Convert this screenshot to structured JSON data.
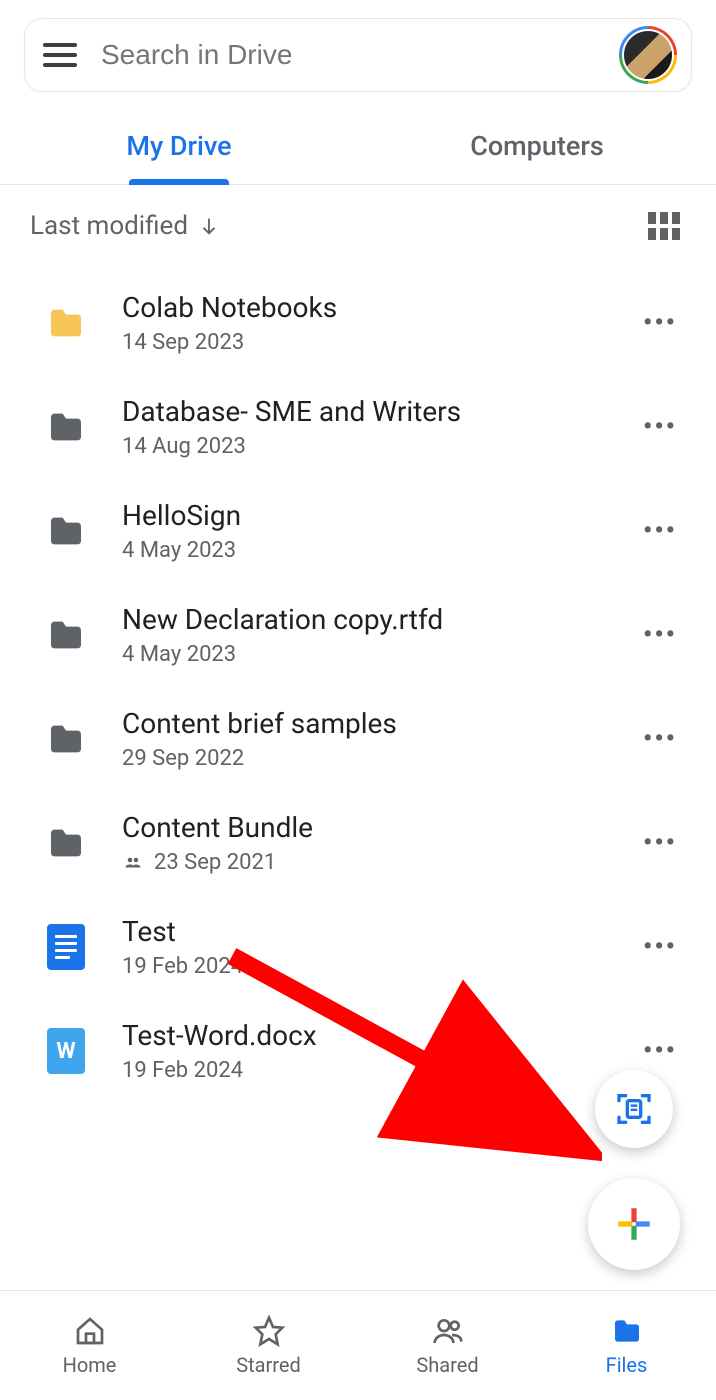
{
  "search": {
    "placeholder": "Search in Drive"
  },
  "tabs": {
    "my_drive": "My Drive",
    "computers": "Computers",
    "active_index": 0
  },
  "sort": {
    "label": "Last modified"
  },
  "files": [
    {
      "name": "Colab Notebooks",
      "date": "14 Sep 2023",
      "type": "folder",
      "color": "#f7c657",
      "shared": false
    },
    {
      "name": "Database- SME and Writers",
      "date": "14 Aug 2023",
      "type": "folder",
      "color": "#5f6368",
      "shared": false
    },
    {
      "name": "HelloSign",
      "date": "4 May 2023",
      "type": "folder",
      "color": "#5f6368",
      "shared": false
    },
    {
      "name": "New Declaration copy.rtfd",
      "date": "4 May 2023",
      "type": "folder",
      "color": "#5f6368",
      "shared": false
    },
    {
      "name": "Content brief samples",
      "date": "29 Sep 2022",
      "type": "folder",
      "color": "#5f6368",
      "shared": false
    },
    {
      "name": "Content Bundle",
      "date": "23 Sep 2021",
      "type": "folder",
      "color": "#5f6368",
      "shared": true
    },
    {
      "name": "Test",
      "date": "19 Feb 2024",
      "type": "gdoc",
      "color": "#1a73e8",
      "shared": false
    },
    {
      "name": "Test-Word.docx",
      "date": "19 Feb 2024",
      "type": "word",
      "color": "#41a5ee",
      "shared": false
    }
  ],
  "nav": {
    "home": "Home",
    "starred": "Starred",
    "shared": "Shared",
    "files": "Files",
    "active": "files"
  }
}
